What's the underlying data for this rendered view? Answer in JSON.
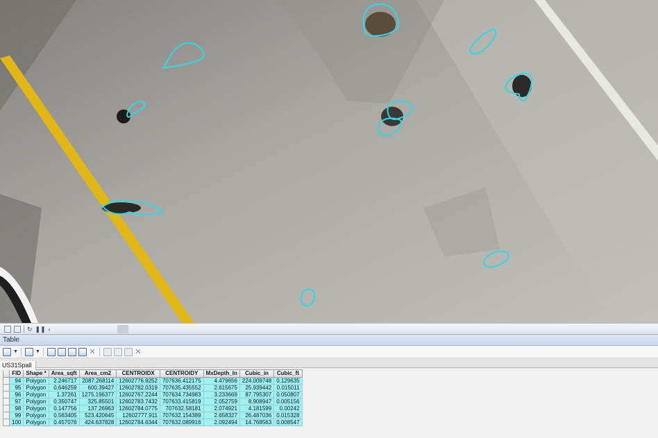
{
  "table_window": {
    "title": "Table",
    "tab_label": "US31Spall"
  },
  "map_view": {
    "description_features": "aerial view of concrete pavement with cyan spall outlines",
    "outline_color": "#33d6e6",
    "lane_line_color": "#e4b80e"
  },
  "table": {
    "columns": [
      "FID",
      "Shape *",
      "Area_sqft",
      "Area_cm2",
      "CENTROIDX",
      "CENTROIDY",
      "MxDepth_In",
      "Cubic_in",
      "Cubic_ft"
    ],
    "rows": [
      [
        "94",
        "Polygon",
        "2.246717",
        "2087.268114",
        "12602776.9252",
        "707636.412175",
        "4.479656",
        "224.009748",
        "0.129635"
      ],
      [
        "95",
        "Polygon",
        "0.646259",
        "600.39427",
        "12602782.0319",
        "707635.435552",
        "2.615675",
        "25.939442",
        "0.015011"
      ],
      [
        "96",
        "Polygon",
        "1.37261",
        "1275.196377",
        "12602767.2244",
        "707634.734983",
        "3.233669",
        "87.795307",
        "0.050807"
      ],
      [
        "97",
        "Polygon",
        "0.350747",
        "325.85501",
        "12602783.7432",
        "707633.415819",
        "2.052759",
        "8.908947",
        "0.005156"
      ],
      [
        "98",
        "Polygon",
        "0.147756",
        "137.26963",
        "12602784.0775",
        "707632.58181",
        "2.074921",
        "4.181599",
        "0.00242"
      ],
      [
        "99",
        "Polygon",
        "0.563405",
        "523.420645",
        "12602777.911",
        "707632.154389",
        "2.658327",
        "26.487036",
        "0.015328"
      ],
      [
        "100",
        "Polygon",
        "0.457076",
        "424.637828",
        "12602784.6344",
        "707632.089916",
        "2.092494",
        "14.768563",
        "0.008547"
      ]
    ]
  },
  "icons": {
    "map_toolbar": [
      "layout-view-icon",
      "data-view-icon",
      "refresh-icon",
      "pause-icon",
      "collapse-icon"
    ],
    "table_toolbar": [
      "table-options-icon",
      "related-tables-icon",
      "select-by-attributes-icon",
      "switch-selection-icon",
      "clear-selection-icon",
      "zoom-to-selected-icon",
      "delete-selected-icon",
      "copy-icon",
      "paste-icon",
      "field-calc-icon",
      "close-x-icon"
    ]
  }
}
